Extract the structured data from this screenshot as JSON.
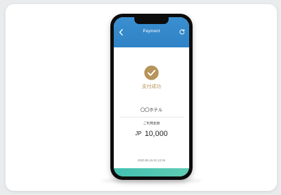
{
  "header": {
    "title": "Payment",
    "back_icon": "chevron-left-icon",
    "refresh_icon": "refresh-icon",
    "color": "#3a8fd0"
  },
  "status": {
    "icon": "check-circle-icon",
    "label": "支付成功",
    "color": "#b7945a"
  },
  "merchant": {
    "name": "〇〇ホテル"
  },
  "amount": {
    "caption": "ご利用金額",
    "currency": "JP",
    "value": "10,000"
  },
  "timestamp": "2020.06.15  01:12:34",
  "footer": {
    "color": "#43c0b2"
  }
}
